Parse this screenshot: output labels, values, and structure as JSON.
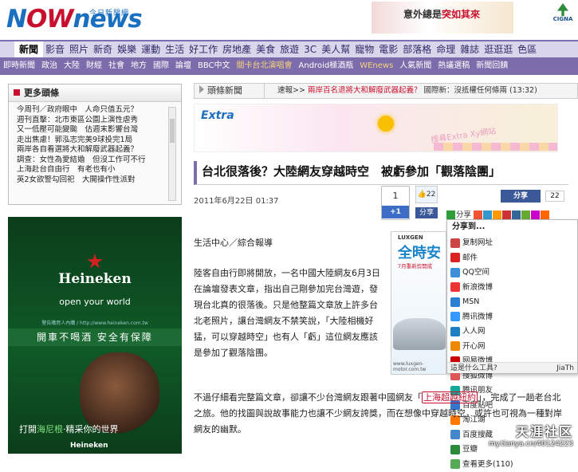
{
  "header": {
    "logo_text_a": "N",
    "logo_text_ow": "OW",
    "logo_text_b": "news",
    "logo_tagline": "今日新聞網",
    "ad_pre": "意外總是",
    "ad_em": "突如其來",
    "brand_right": "CIGNA"
  },
  "nav_primary": [
    "新聞",
    "影音",
    "照片",
    "新奇",
    "娛樂",
    "運動",
    "生活",
    "好工作",
    "房地產",
    "美食",
    "旅遊",
    "3C",
    "美人幫",
    "寵物",
    "電影",
    "部落格",
    "命理",
    "雜誌",
    "逛逛逛",
    "色區"
  ],
  "nav_secondary": [
    "即時新聞",
    "政治",
    "大陸",
    "財經",
    "社會",
    "地方",
    "國際",
    "論壇",
    "BBC中文",
    "關卡台北演唱會",
    "Android極酒瓶",
    "WEnews",
    "人氣新聞",
    "熱議選稿",
    "新聞回饋"
  ],
  "more_headlines": {
    "title": "更多頭條",
    "items": [
      "今周刊／政府眼中　人命只值五元？",
      "週刊直擊：北市東區公園上演性虐秀",
      "又一低壓可能變颱　估週末影響台灣",
      "走出焦慮！郭泓志完美9球投完1局",
      "兩岸各自看選將大和解廢武器起義？",
      "調查：女性為愛結婚　但沒工作可不行",
      "上海赴台自由行　有老也有小",
      "英2女欲警勾回祀　大開操作性派對"
    ]
  },
  "heineken_ad": {
    "brand": "Heineken",
    "slogan": "open your world",
    "fine_print": "警告購買人內購 / http://www.heineken.com.tw",
    "warning": "開車不喝酒 安全有保障",
    "caption_pre": "打開",
    "caption_em": "海尼根",
    "caption_post": "·精采你的世界",
    "footer": "Heineken"
  },
  "news_bar": {
    "tab": "頭條新聞",
    "ticker_label": "速報>>",
    "ticker_hot": "兩岸百名退將大和解廢武器起義？",
    "ticker_rest": "國際新：沒抵權任何條兩 (13:32)"
  },
  "extra_banner": {
    "logo": "Extra",
    "marquee": "搜尋Extra Xy網站"
  },
  "article": {
    "title": "台北很落後？大陸網友穿越時空　被虧參加「觀落陰團」",
    "date": "2011年6月22日 01:37",
    "source": "生活中心／綜合報導",
    "para1": "陸客自由行即將開放，一名中國大陸網友6月3日在論壇發表文章，指出自己剛參加完台灣遊，發現台北真的很落後。只是他整篇文章放上許多台北老照片，讓台灣網友不禁笑說，「大陸相機好猛，可以穿越時空」也有人「虧」這位網友應該是參加了觀落陰團。",
    "para2_pre": "不過仔細看完整篇文章，卻讓不少台灣網友跟著中國網友「",
    "para2_link": "上海超越紐約",
    "para2_post": "」，完成了一趟老台北之旅。他的找圖與說故事能力也讓不少網友誇獎，而在想像中穿越時空，或許也可視為一種對岸網友的幽默。"
  },
  "social": {
    "vote_count": "1",
    "vote_plus": "+1",
    "like_count": "22",
    "like_share": "分享",
    "fb_share": "分享",
    "fb_share_count": "22",
    "share_label": "分享",
    "share_to": "分享到...",
    "share_items": [
      "复制网址",
      "邮件",
      "QQ空间",
      "新浪微博",
      "MSN",
      "腾讯微博",
      "人人网",
      "开心网",
      "网易微博",
      "搜狐微博",
      "腾讯朋友",
      "百度贴吧",
      "淘江湖",
      "百度搜藏",
      "豆瓣",
      "查看更多(110)"
    ],
    "share_footer": "這是什么工具?",
    "share_footer_brand": "JiaTh"
  },
  "luxgen_ad": {
    "brand": "LUXGEN",
    "headline": "全時安",
    "sub": "7月重新剪開成",
    "url": "www.luxgen-motor.com.tw"
  },
  "watermark": {
    "name": "天涯社区",
    "url": "my.tianya.cn/40124223"
  },
  "colors": {
    "brand_blue": "#1a6fc1",
    "brand_red": "#c8102e",
    "nav_purple": "#7d6cab",
    "nav_light": "#d9d5ea"
  }
}
